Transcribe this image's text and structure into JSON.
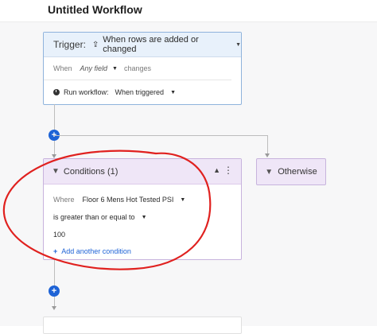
{
  "workflow": {
    "title": "Untitled Workflow"
  },
  "trigger": {
    "label": "Trigger:",
    "event": "When rows are added or changed",
    "when_label": "When",
    "field_value": "Any field",
    "changes_label": "changes",
    "run_label": "Run workflow:",
    "run_value": "When triggered"
  },
  "conditions": {
    "title": "Conditions (1)",
    "where_label": "Where",
    "field_value": "Floor 6 Mens Hot Tested PSI",
    "operator_value": "is greater than or equal to",
    "value": "100",
    "add_label": "Add another condition"
  },
  "otherwise": {
    "title": "Otherwise"
  },
  "colors": {
    "accent": "#1e63d6",
    "trigger_header": "#e8f1fb",
    "condition_header": "#efe6f7",
    "annotation": "#e0211f"
  },
  "icons": {
    "trigger_event": "upload-icon",
    "run": "clock-icon",
    "conditions": "filter-icon",
    "collapse": "chevron-up-icon",
    "menu": "kebab-menu-icon",
    "add_step": "plus-circle-icon",
    "otherwise": "filter-icon"
  }
}
